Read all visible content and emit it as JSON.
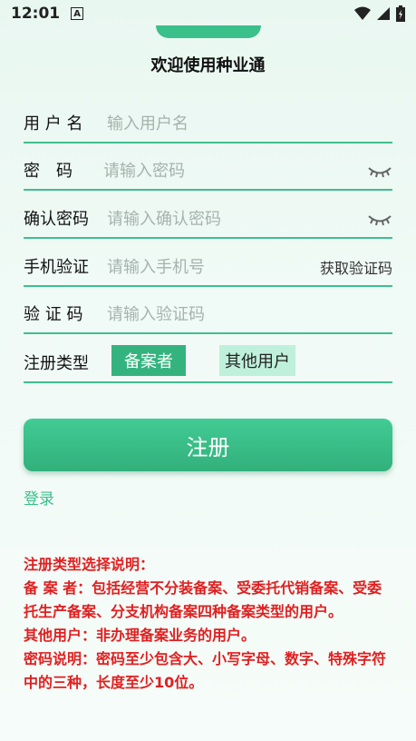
{
  "status_bar": {
    "time": "12:01",
    "notif": "A"
  },
  "welcome": "欢迎使用种业通",
  "form": {
    "username": {
      "label": "用 户 名",
      "placeholder": "输入用户名"
    },
    "password": {
      "label": "密　码",
      "placeholder": "请输入密码"
    },
    "confirm": {
      "label": "确认密码",
      "placeholder": "请输入确认密码"
    },
    "phone": {
      "label": "手机验证",
      "placeholder": "请输入手机号",
      "action": "获取验证码"
    },
    "code": {
      "label": "验 证 码",
      "placeholder": "请输入验证码"
    },
    "type": {
      "label": "注册类型",
      "options": [
        "备案者",
        "其他用户"
      ],
      "selected": "备案者"
    }
  },
  "register_label": "注册",
  "login_label": "登录",
  "notes": [
    "注册类型选择说明：",
    "备 案 者：包括经营不分装备案、受委托代销备案、受委托生产备案、分支机构备案四种备案类型的用户。",
    "其他用户：非办理备案业务的用户。",
    "密码说明：密码至少包含大、小写字母、数字、特殊字符中的三种，长度至少10位。"
  ],
  "colors": {
    "accent": "#3bbf8b",
    "note": "#e02020"
  }
}
